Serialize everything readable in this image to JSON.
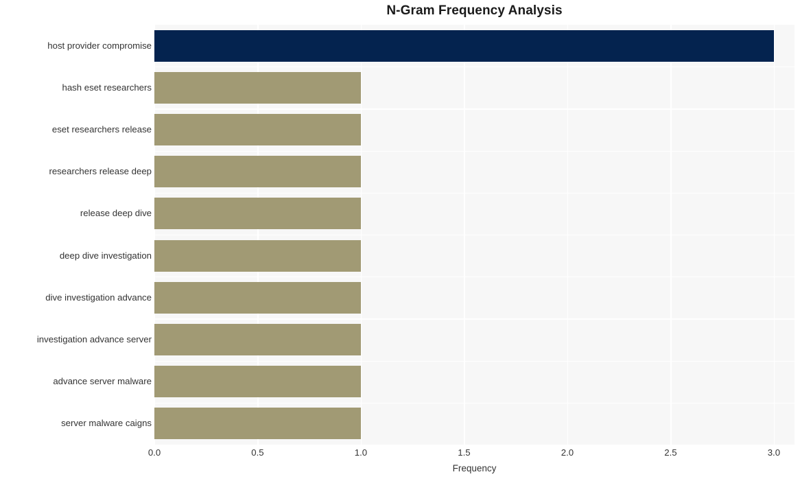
{
  "chart_data": {
    "type": "bar",
    "orientation": "horizontal",
    "title": "N-Gram Frequency Analysis",
    "xlabel": "Frequency",
    "ylabel": "",
    "xlim": [
      0,
      3.1
    ],
    "xticks": [
      "0.0",
      "0.5",
      "1.0",
      "1.5",
      "2.0",
      "2.5",
      "3.0"
    ],
    "xtick_values": [
      0.0,
      0.5,
      1.0,
      1.5,
      2.0,
      2.5,
      3.0
    ],
    "grid": true,
    "legend": false,
    "categories": [
      "host provider compromise",
      "hash eset researchers",
      "eset researchers release",
      "researchers release deep",
      "release deep dive",
      "deep dive investigation",
      "dive investigation advance",
      "investigation advance server",
      "advance server malware",
      "server malware caigns"
    ],
    "values": [
      3,
      1,
      1,
      1,
      1,
      1,
      1,
      1,
      1,
      1
    ],
    "bar_colors": [
      "#04234f",
      "#a19a74",
      "#a19a74",
      "#a19a74",
      "#a19a74",
      "#a19a74",
      "#a19a74",
      "#a19a74",
      "#a19a74",
      "#a19a74"
    ],
    "plot_background": "#f7f7f7",
    "grid_color": "#ffffff",
    "figure_background": "#ffffff",
    "highlight_color": "#04234f",
    "default_bar_color": "#a19a74"
  }
}
